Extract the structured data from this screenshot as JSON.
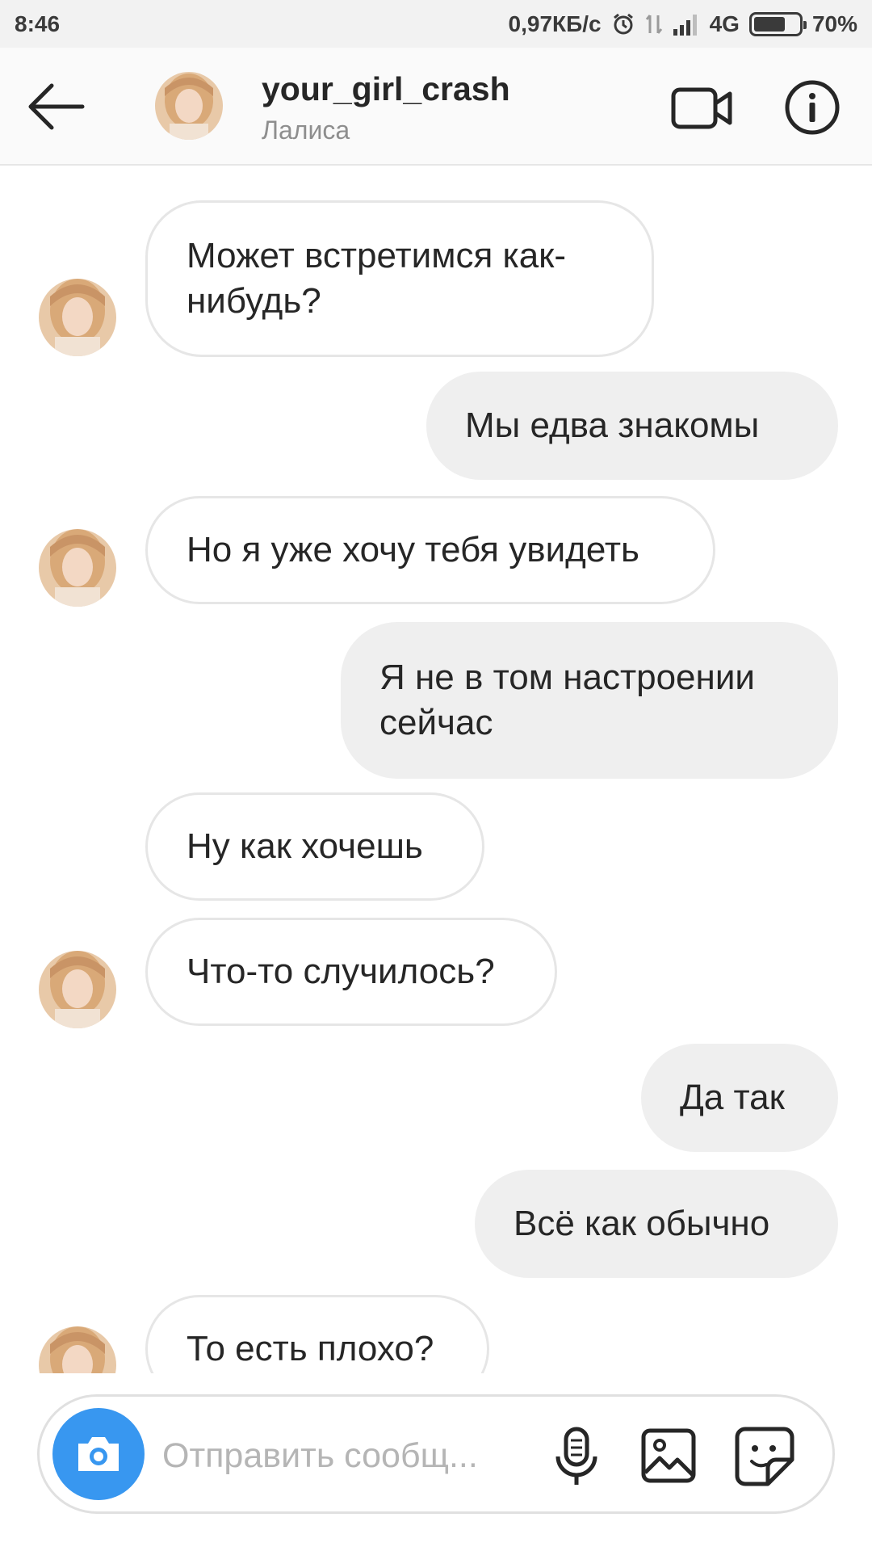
{
  "status_bar": {
    "time": "8:46",
    "network_speed": "0,97КБ/с",
    "network_type": "4G",
    "battery": "70%",
    "battery_level": 0.7
  },
  "header": {
    "username": "your_girl_crash",
    "display_name": "Лалиса"
  },
  "messages": [
    {
      "direction": "incoming",
      "lines": [
        "Может встретимся как-",
        "нибудь?"
      ],
      "show_avatar": true
    },
    {
      "direction": "outgoing",
      "lines": [
        "Мы едва знакомы"
      ],
      "show_avatar": false
    },
    {
      "direction": "incoming",
      "lines": [
        "Но я уже хочу тебя увидеть"
      ],
      "show_avatar": true
    },
    {
      "direction": "outgoing",
      "lines": [
        "Я не в том настроении",
        "сейчас"
      ],
      "show_avatar": false
    },
    {
      "direction": "incoming",
      "lines": [
        "Ну как хочешь"
      ],
      "show_avatar": false
    },
    {
      "direction": "incoming",
      "lines": [
        "Что-то случилось?"
      ],
      "show_avatar": true
    },
    {
      "direction": "outgoing",
      "lines": [
        "Да так"
      ],
      "show_avatar": false
    },
    {
      "direction": "outgoing",
      "lines": [
        "Всё как обычно"
      ],
      "show_avatar": false
    },
    {
      "direction": "incoming",
      "lines": [
        "То есть плохо?"
      ],
      "show_avatar": true
    }
  ],
  "composer": {
    "placeholder": "Отправить сообщ..."
  },
  "colors": {
    "accent": "#3897f0",
    "outgoing_bubble": "#efefef",
    "incoming_border": "#e6e6e6"
  },
  "icons": {
    "back": "arrow-left-icon",
    "video": "video-camera-icon",
    "info": "info-icon",
    "camera": "camera-icon",
    "mic": "microphone-icon",
    "gallery": "image-icon",
    "sticker": "sticker-icon"
  }
}
